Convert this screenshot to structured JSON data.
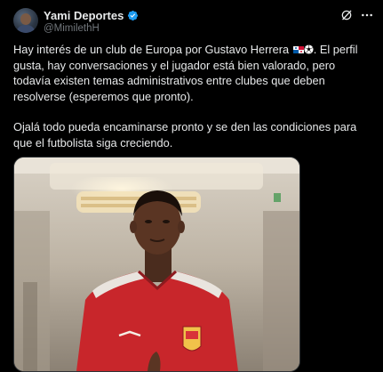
{
  "author": {
    "display_name": "Yami Deportes",
    "handle": "@MimilethH",
    "icons": [
      "verified-badge-icon",
      "grok-icon",
      "more-icon"
    ]
  },
  "tweet": {
    "paragraph1_before": "Hay interés de un club de Europa por Gustavo Herrera ",
    "paragraph1_after": ". El perfil gusta, hay conversaciones y el jugador está bien valorado, pero todavía existen temas administrativos entre clubes que deben resolverse (esperemos que pronto).",
    "paragraph2": "Ojalá todo pueda encaminarse pronto y se den las condiciones para que el futbolista siga creciendo.",
    "emoji": [
      "panama-flag-icon",
      "soccer-ball-icon"
    ]
  },
  "colors": {
    "background": "#000000",
    "text": "#e7e9ea",
    "secondary_text": "#71767b",
    "verified": "#1d9bf0",
    "jersey": "#c8262b"
  }
}
